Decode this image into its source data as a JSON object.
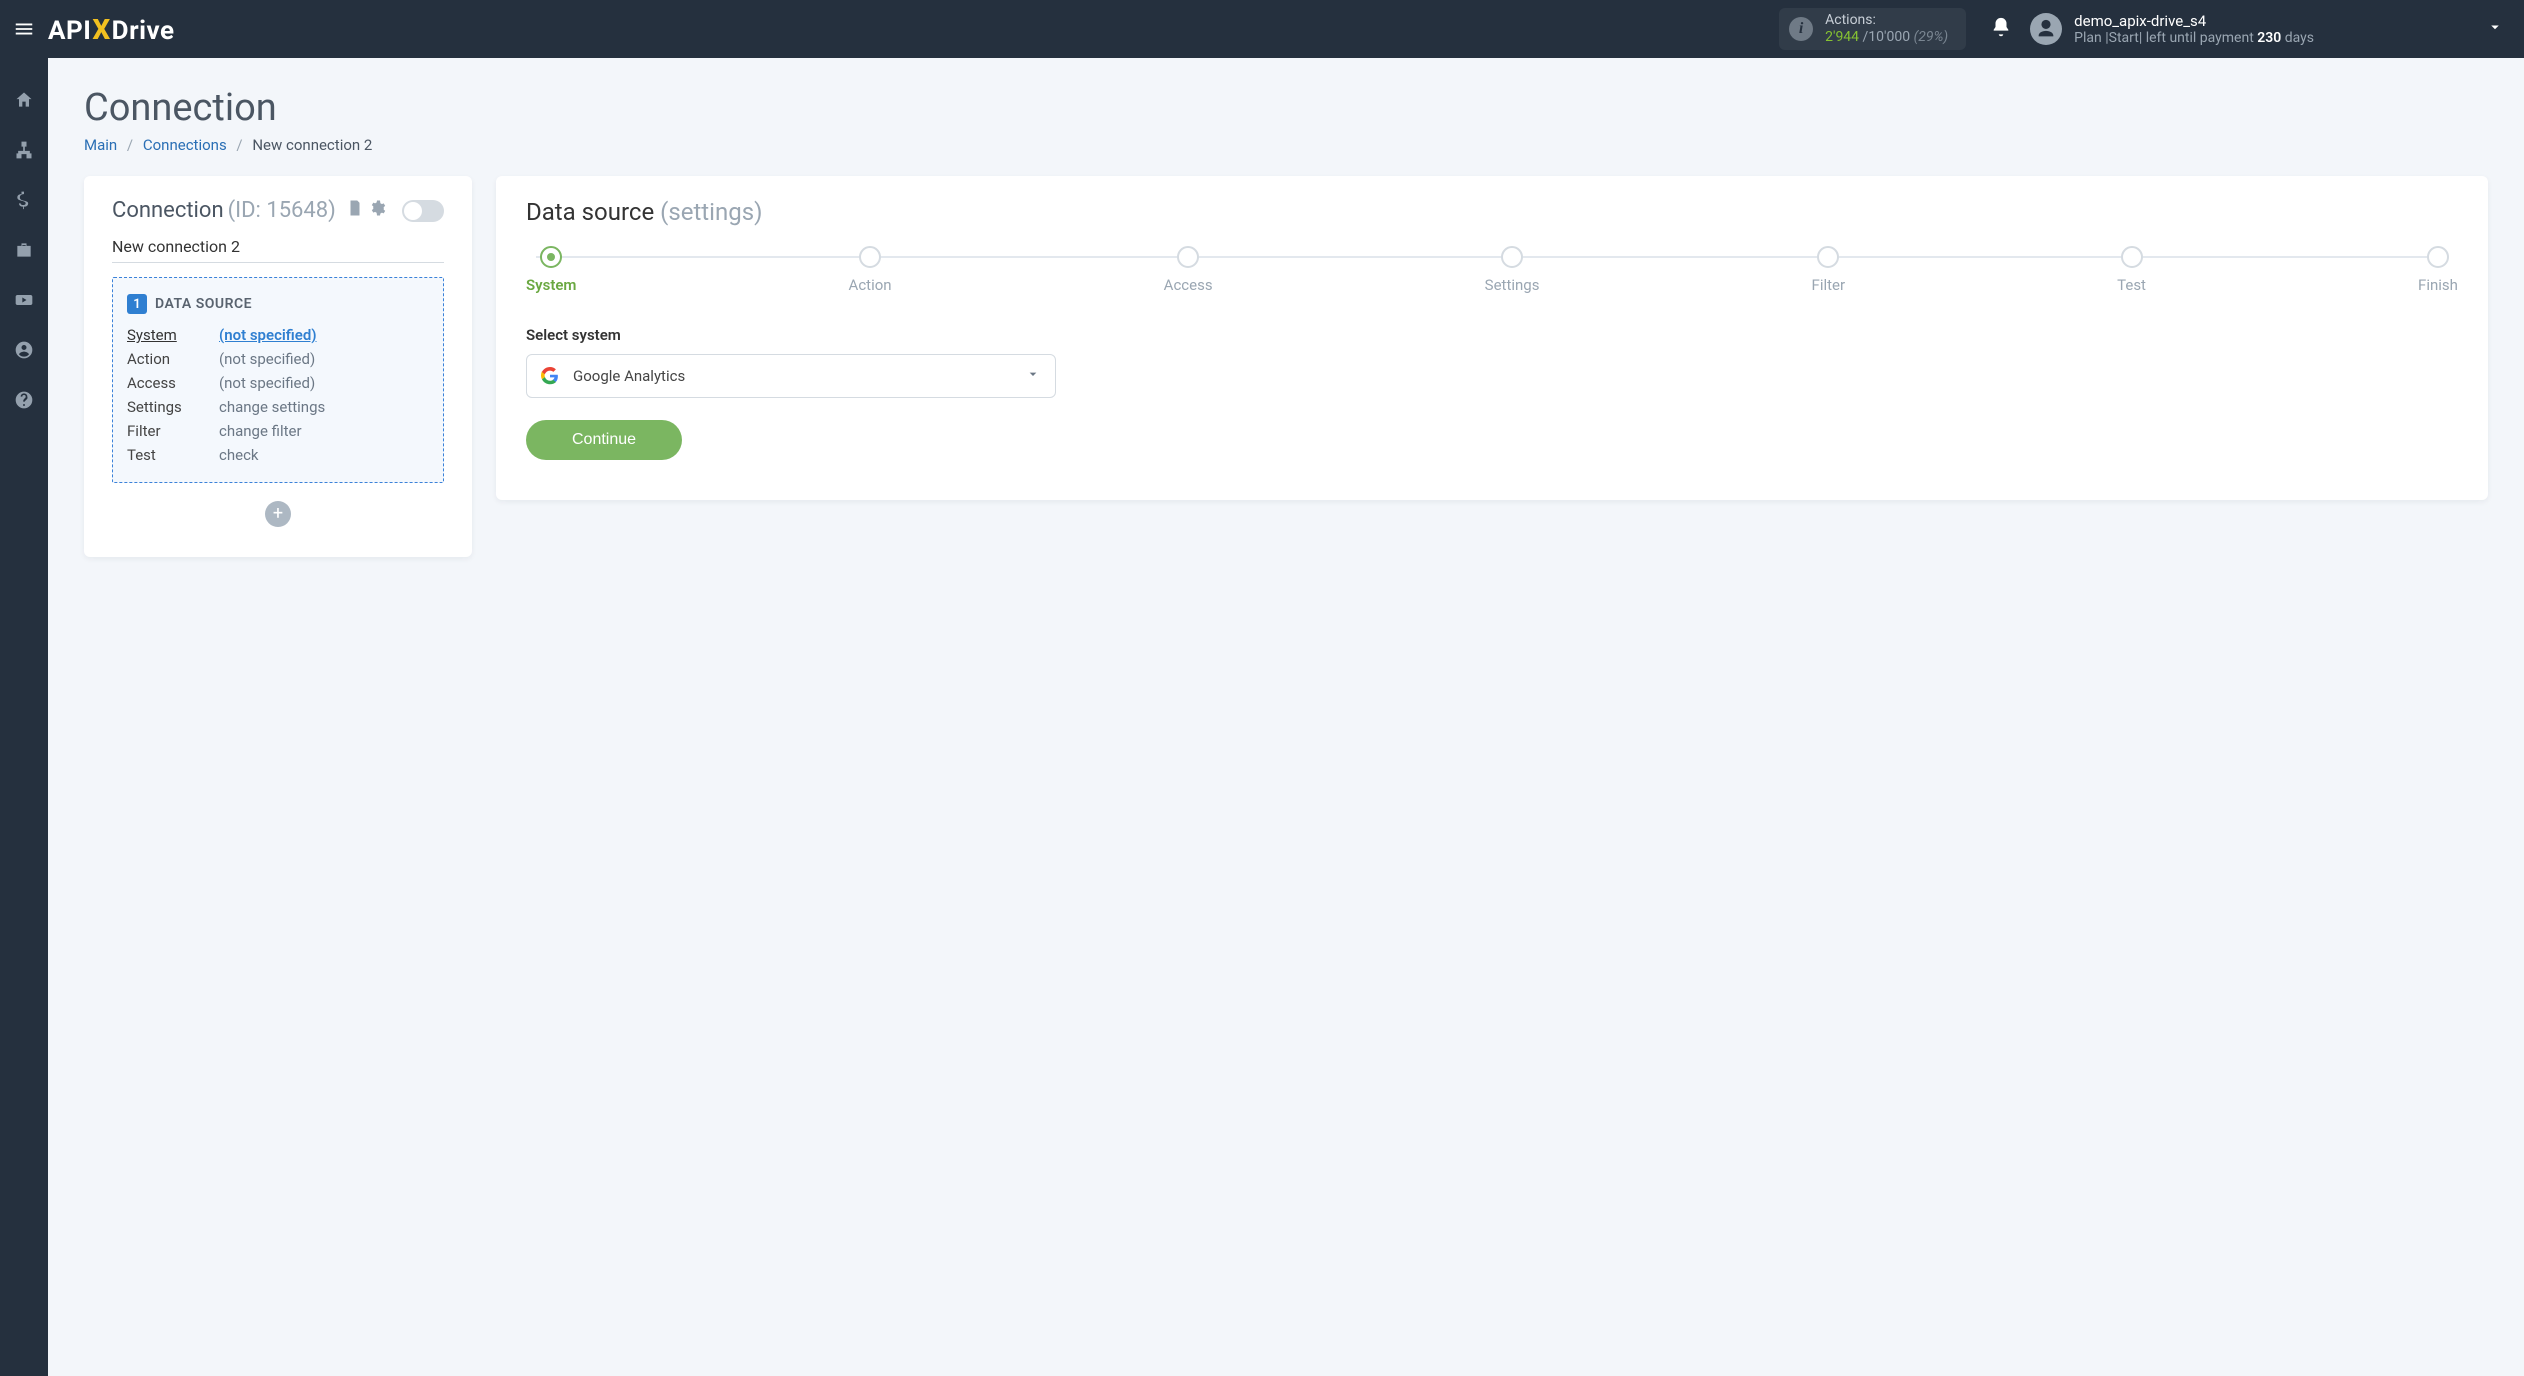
{
  "header": {
    "actions_label": "Actions:",
    "actions_used": "2'944",
    "actions_sep": " /",
    "actions_total": "10'000",
    "actions_pct": "(29%)",
    "user_name": "demo_apix-drive_s4",
    "plan_prefix": "Plan |Start| left until payment ",
    "plan_days": "230",
    "plan_suffix": " days"
  },
  "sidebar_items": [
    "home",
    "sitemap",
    "dollar",
    "briefcase",
    "youtube",
    "user",
    "help"
  ],
  "page": {
    "title": "Connection",
    "bc_main": "Main",
    "bc_connections": "Connections",
    "bc_current": "New connection 2"
  },
  "left": {
    "title": "Connection",
    "id_label": "(ID: 15648)",
    "conn_name": "New connection 2",
    "ds_badge": "1",
    "ds_title": "DATA SOURCE",
    "rows": [
      {
        "label": "System",
        "value": "(not specified)",
        "active": true
      },
      {
        "label": "Action",
        "value": "(not specified)",
        "active": false
      },
      {
        "label": "Access",
        "value": "(not specified)",
        "active": false
      },
      {
        "label": "Settings",
        "value": "change settings",
        "active": false
      },
      {
        "label": "Filter",
        "value": "change filter",
        "active": false
      },
      {
        "label": "Test",
        "value": "check",
        "active": false
      }
    ]
  },
  "right": {
    "title": "Data source",
    "subtitle": "(settings)",
    "steps": [
      "System",
      "Action",
      "Access",
      "Settings",
      "Filter",
      "Test",
      "Finish"
    ],
    "active_step_index": 0,
    "select_label": "Select system",
    "selected_system": "Google Analytics",
    "continue_label": "Continue"
  }
}
